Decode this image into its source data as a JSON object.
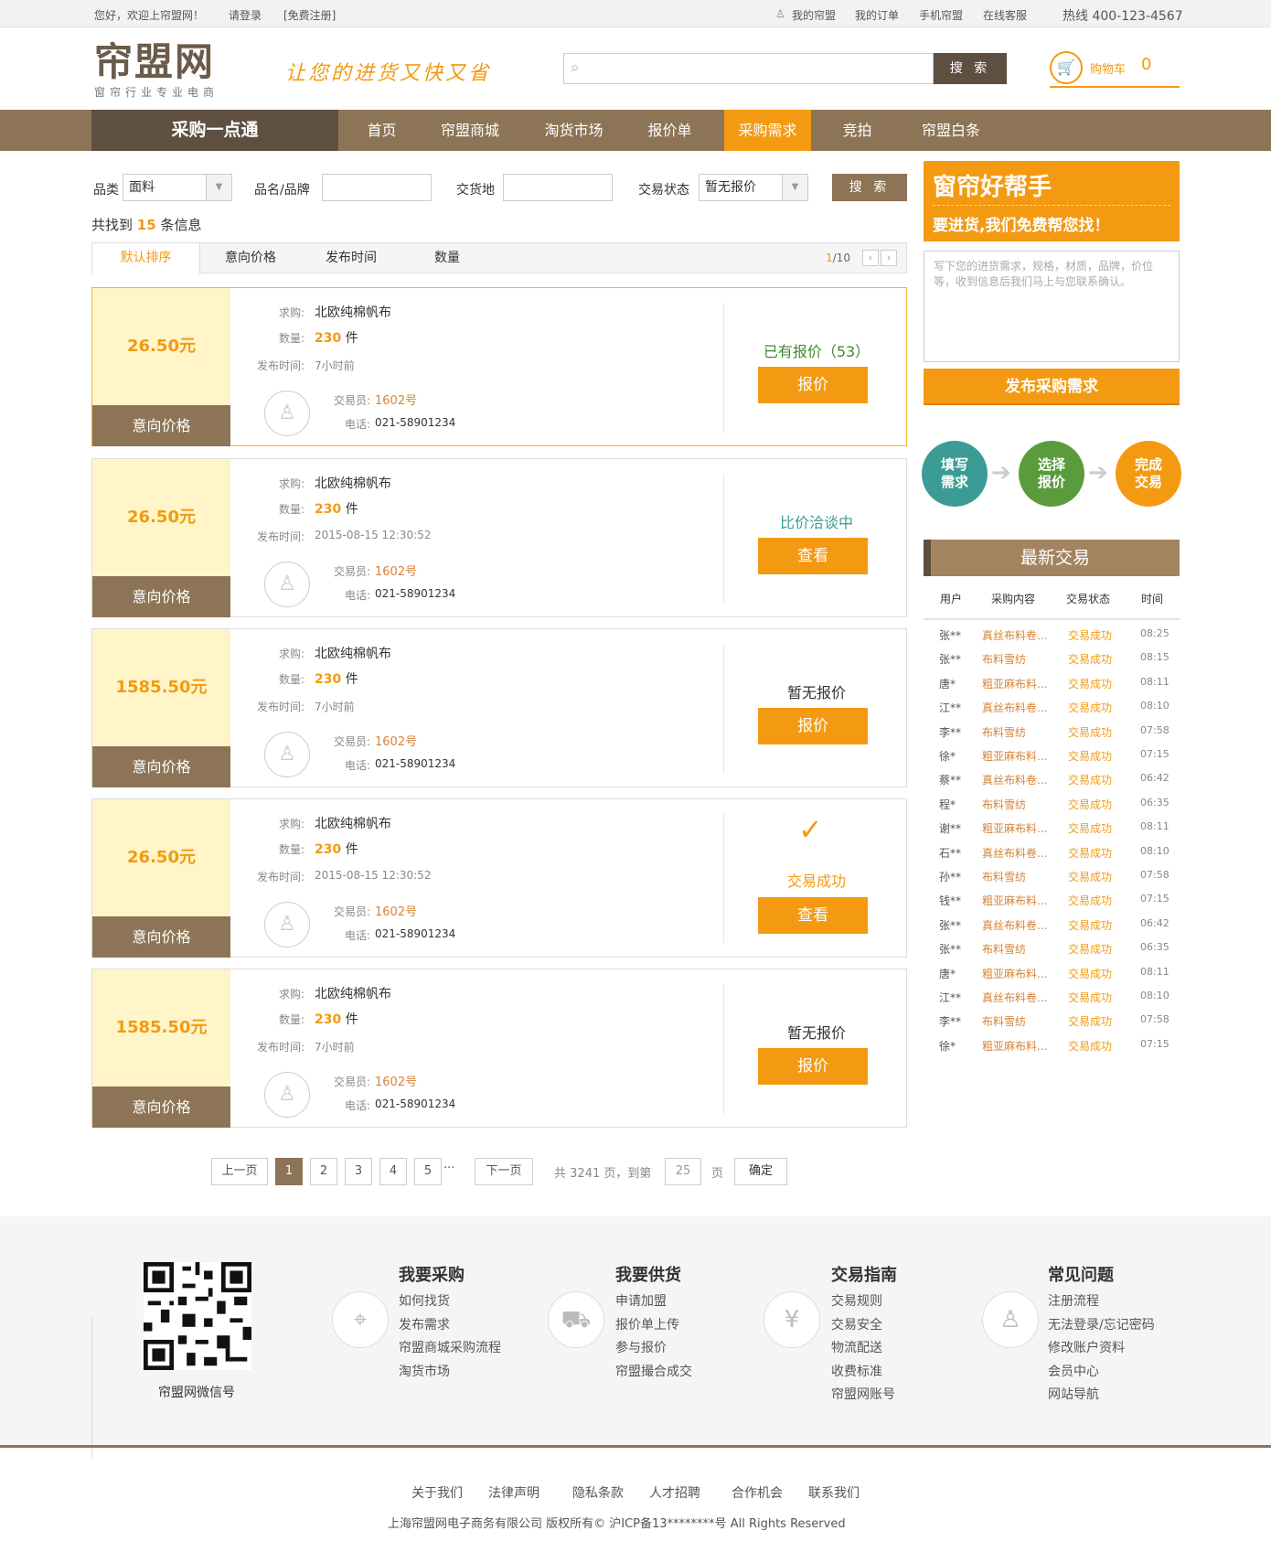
{
  "topbar": {
    "welcome": "您好，欢迎上帘盟网！",
    "login": "请登录",
    "register": "[免费注册]",
    "my": "我的帘盟",
    "orders": "我的订单",
    "mobile": "手机帘盟",
    "service": "在线客服",
    "hotline": "热线 400-123-4567"
  },
  "header": {
    "logo": "帘盟网",
    "logo_sub": "窗帘行业专业电商",
    "slogan": "让您的进货又快又省",
    "search_placeholder": "",
    "search_btn": "搜 索",
    "cart_label": "购物车",
    "cart_count": "0"
  },
  "nav": {
    "brand": "采购一点通",
    "items": [
      "首页",
      "帘盟商城",
      "淘货市场",
      "报价单",
      "采购需求",
      "竞拍",
      "帘盟白条"
    ],
    "active": "采购需求"
  },
  "filter": {
    "cat_label": "品类",
    "cat_value": "面料",
    "name_label": "品名/品牌",
    "name_value": "",
    "place_label": "交货地",
    "place_value": "",
    "status_label": "交易状态",
    "status_value": "暂无报价",
    "btn": "搜 索"
  },
  "found": {
    "pre": "共找到",
    "count": "15",
    "post": "条信息"
  },
  "sort": {
    "tabs": [
      "默认排序",
      "意向价格",
      "发布时间",
      "数量"
    ],
    "page_cur": "1",
    "page_total": "/10"
  },
  "labels": {
    "seek": "求购:",
    "qty": "数量:",
    "time": "发布时间:",
    "trader": "交易员:",
    "phone": "电话:",
    "price_lbl": "意向价格",
    "unit": "件"
  },
  "cards": [
    {
      "price": "26.50元",
      "title": "北欧纯棉帆布",
      "qty": "230",
      "time": "7小时前",
      "trader": "1602号",
      "phone": "021-58901234",
      "status": "已有报价（53）",
      "action": "报价"
    },
    {
      "price": "26.50元",
      "title": "北欧纯棉帆布",
      "qty": "230",
      "time": "2015-08-15 12:30:52",
      "trader": "1602号",
      "phone": "021-58901234",
      "status": "比价洽谈中",
      "action": "查看"
    },
    {
      "price": "1585.50元",
      "title": "北欧纯棉帆布",
      "qty": "230",
      "time": "7小时前",
      "trader": "1602号",
      "phone": "021-58901234",
      "status": "暂无报价",
      "action": "报价"
    },
    {
      "price": "26.50元",
      "title": "北欧纯棉帆布",
      "qty": "230",
      "time": "2015-08-15 12:30:52",
      "trader": "1602号",
      "phone": "021-58901234",
      "status": "交易成功",
      "action": "查看"
    },
    {
      "price": "1585.50元",
      "title": "北欧纯棉帆布",
      "qty": "230",
      "time": "7小时前",
      "trader": "1602号",
      "phone": "021-58901234",
      "status": "暂无报价",
      "action": "报价"
    }
  ],
  "pagination": {
    "prev": "上一页",
    "pages": [
      "1",
      "2",
      "3",
      "4",
      "5"
    ],
    "ellipsis": "···",
    "next": "下一页",
    "total_pre": "共",
    "total": "3241",
    "total_mid": "页，到第",
    "goto": "25",
    "total_post": "页",
    "confirm": "确定"
  },
  "side": {
    "helper_title": "窗帘好帮手",
    "helper_sub": "要进货,我们免费帮您找！",
    "textarea": "写下您的进货需求，规格，材质，品牌，价位等，收到信息后我们马上与您联系确认。",
    "publish": "发布采购需求",
    "steps": [
      "填写需求",
      "选择报价",
      "完成交易"
    ],
    "latest": "最新交易",
    "th": [
      "用户",
      "采购内容",
      "交易状态",
      "时间"
    ],
    "rows": [
      [
        "张**",
        "真丝布料卷...",
        "交易成功",
        "08:25"
      ],
      [
        "张**",
        "布料雪纺",
        "交易成功",
        "08:15"
      ],
      [
        "唐*",
        "粗亚麻布料...",
        "交易成功",
        "08:11"
      ],
      [
        "江**",
        "真丝布料卷...",
        "交易成功",
        "08:10"
      ],
      [
        "李**",
        "布料雪纺",
        "交易成功",
        "07:58"
      ],
      [
        "徐*",
        "粗亚麻布料...",
        "交易成功",
        "07:15"
      ],
      [
        "蔡**",
        "真丝布料卷...",
        "交易成功",
        "06:42"
      ],
      [
        "程*",
        "布料雪纺",
        "交易成功",
        "06:35"
      ],
      [
        "谢**",
        "粗亚麻布料...",
        "交易成功",
        "08:11"
      ],
      [
        "石**",
        "真丝布料卷...",
        "交易成功",
        "08:10"
      ],
      [
        "孙**",
        "布料雪纺",
        "交易成功",
        "07:58"
      ],
      [
        "钱**",
        "粗亚麻布料...",
        "交易成功",
        "07:15"
      ],
      [
        "张**",
        "真丝布料卷...",
        "交易成功",
        "06:42"
      ],
      [
        "张**",
        "布料雪纺",
        "交易成功",
        "06:35"
      ],
      [
        "唐*",
        "粗亚麻布料...",
        "交易成功",
        "08:11"
      ],
      [
        "江**",
        "真丝布料卷...",
        "交易成功",
        "08:10"
      ],
      [
        "李**",
        "布料雪纺",
        "交易成功",
        "07:58"
      ],
      [
        "徐*",
        "粗亚麻布料...",
        "交易成功",
        "07:15"
      ]
    ]
  },
  "footer": {
    "qr_caption": "帘盟网微信号",
    "cols": [
      {
        "title": "我要采购",
        "icon": "compass-icon",
        "items": [
          "如何找货",
          "发布需求",
          "帘盟商城采购流程",
          "淘货市场"
        ]
      },
      {
        "title": "我要供货",
        "icon": "truck-icon",
        "items": [
          "申请加盟",
          "报价单上传",
          "参与报价",
          "帘盟撮合成交"
        ]
      },
      {
        "title": "交易指南",
        "icon": "yen-icon",
        "items": [
          "交易规则",
          "交易安全",
          "物流配送",
          "收费标准",
          "帘盟网账号"
        ]
      },
      {
        "title": "常见问题",
        "icon": "user-icon",
        "items": [
          "注册流程",
          "无法登录/忘记密码",
          "修改账户资料",
          "会员中心",
          "网站导航"
        ]
      }
    ],
    "links": [
      "关于我们",
      "法律声明",
      "隐私条款",
      "人才招聘",
      "合作机会",
      "联系我们"
    ],
    "copyright": "上海帘盟网电子商务有限公司 版权所有©  沪ICP备13********号 All Rights Reserved"
  },
  "colors": {
    "accent": "#f39a12",
    "brown": "#8d7456",
    "dark": "#5e4f41",
    "teal": "#3a9c94",
    "green": "#5a9c3c",
    "cream": "#fff5c8"
  }
}
